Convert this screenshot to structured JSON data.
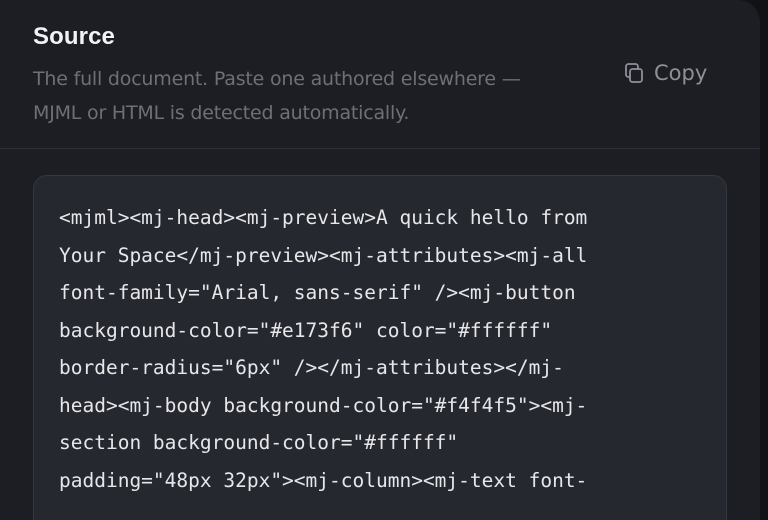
{
  "source": {
    "title": "Source",
    "description_line1": "The full document. Paste one authored elsewhere —",
    "description_line2": "MJML or HTML is detected automatically.",
    "copy_label": "Copy",
    "copy_icon": "copy-icon",
    "code_lines": [
      "<mjml><mj-head><mj-preview>A quick hello from",
      "Your Space</mj-preview><mj-attributes><mj-all",
      "font-family=\"Arial, sans-serif\" /><mj-button",
      "background-color=\"#e173f6\" color=\"#ffffff\"",
      "border-radius=\"6px\" /></mj-attributes></mj-",
      "head><mj-body background-color=\"#f4f4f5\"><mj-",
      "section background-color=\"#ffffff\"",
      "padding=\"48px 32px\"><mj-column><mj-text font-"
    ]
  }
}
